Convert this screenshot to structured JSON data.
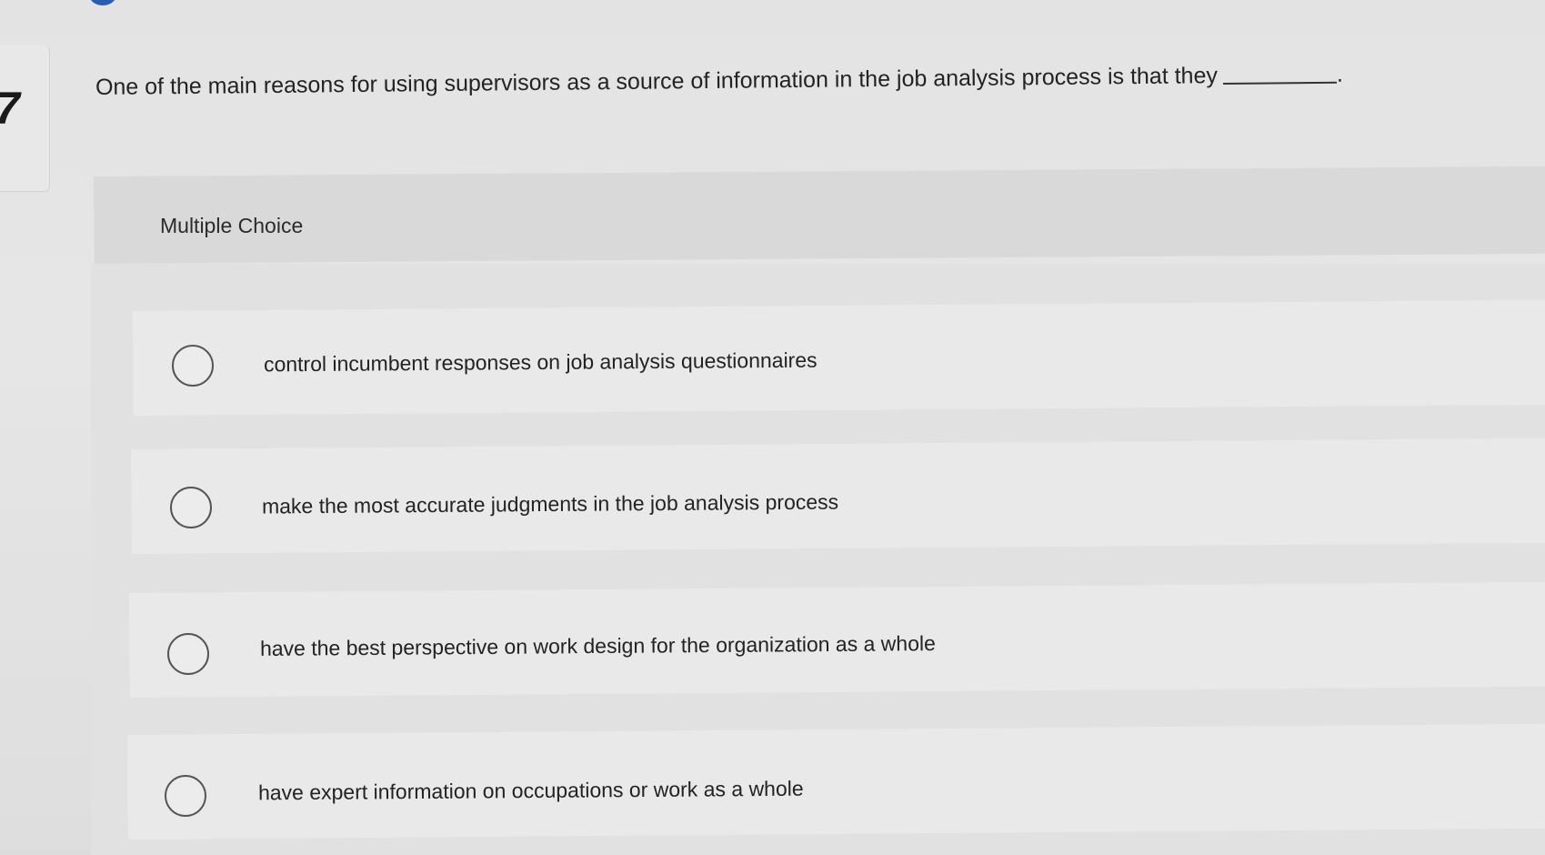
{
  "question": {
    "number": "7",
    "text": "One of the main reasons for using supervisors as a source of information in the job analysis process is that they",
    "end_mark": "."
  },
  "section": {
    "label": "Multiple Choice"
  },
  "options": [
    {
      "label": "control incumbent responses on job analysis questionnaires"
    },
    {
      "label": "make the most accurate judgments in the job analysis process"
    },
    {
      "label": "have the best perspective on work design for the organization as a whole"
    },
    {
      "label": "have expert information on occupations or work as a whole"
    }
  ]
}
